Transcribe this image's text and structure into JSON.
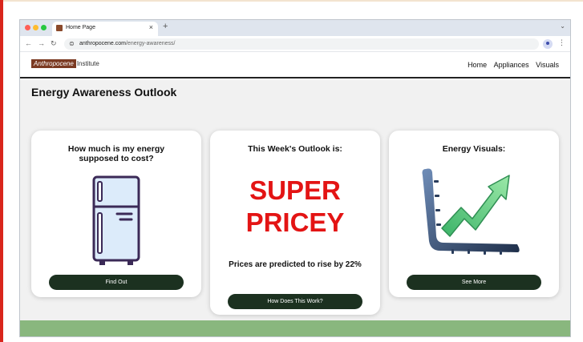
{
  "browser": {
    "tab_title": "Home Page",
    "tab_close": "×",
    "new_tab": "+",
    "tab_menu": "⌄",
    "url_host": "anthropocene.com",
    "url_path": "/energy-awareness/",
    "nav_back": "←",
    "nav_forward": "→",
    "nav_reload": "↻",
    "site_info_icon": "⊜",
    "menu_icon": "⋮"
  },
  "site": {
    "logo_part1": "Anthropocene",
    "logo_part2": "Institute",
    "nav": [
      "Home",
      "Appliances",
      "Visuals"
    ]
  },
  "main": {
    "title": "Energy Awareness Outlook",
    "cards": {
      "cost": {
        "title": "How much is my energy supposed to cost?",
        "button": "Find Out",
        "icon": "refrigerator-icon"
      },
      "outlook": {
        "title": "This Week's Outlook is:",
        "line1": "SUPER",
        "line2": "PRICEY",
        "prediction": "Prices are predicted to rise by 22%",
        "button": "How Does This Work?"
      },
      "visuals": {
        "title": "Energy Visuals:",
        "button": "See More",
        "icon": "rising-chart-icon"
      }
    }
  },
  "colors": {
    "accent_red": "#e31414",
    "button_dark_green": "#1c3120",
    "footer_green": "#89b77e",
    "logo_brown": "#7b3a22"
  }
}
